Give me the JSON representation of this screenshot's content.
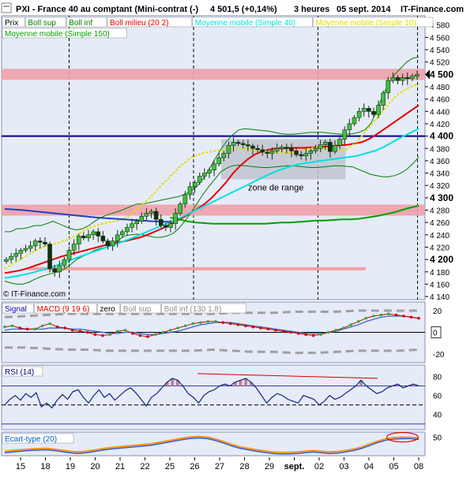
{
  "header": {
    "instrument": "PXI - France 40 au comptant (Mini-contrat  (-)",
    "price": "4 501,5 (+0,14%)",
    "interval": "3 heures",
    "date": "05 sept. 2014",
    "brand": "IT-Finance.com"
  },
  "legend_main": [
    {
      "label": "Prix",
      "color": "#000000"
    },
    {
      "label": "Boll sup",
      "color": "#008000"
    },
    {
      "label": "Boll inf",
      "color": "#008000"
    },
    {
      "label": "Boll milieu (20 2)",
      "color": "#e00000"
    },
    {
      "label": "Moyenne mobile (Simple 40)",
      "color": "#00e0e0"
    },
    {
      "label": "Moyenne mobile (Simple 10)",
      "color": "#e0e000"
    },
    {
      "label": "Moyenne mobile (Simple 150)",
      "color": "#00a000"
    }
  ],
  "copyright": "© IT-Finance.com",
  "annotation_range": "zone de range",
  "legend_macd": [
    {
      "label": "Signal",
      "color": "#0000c0"
    },
    {
      "label": "MACD (9 19 6)",
      "color": "#e00000"
    },
    {
      "label": "zero",
      "color": "#000000"
    },
    {
      "label": "Boll sup",
      "color": "#909090"
    },
    {
      "label": "Boll inf (130 1,8)",
      "color": "#909090"
    }
  ],
  "legend_rsi": [
    {
      "label": "RSI (14)",
      "color": "#000080"
    }
  ],
  "legend_ecart": [
    {
      "label": "Ecart-type (20)",
      "color": "#0060c0"
    }
  ],
  "chart_data": {
    "type": "line",
    "title": "PXI - France 40 au comptant (Mini-contrat  (-)",
    "x_ticks": [
      "15",
      "18",
      "19",
      "20",
      "21",
      "22",
      "25",
      "26",
      "27",
      "28",
      "29",
      "sept.",
      "02",
      "03",
      "04",
      "05",
      "08"
    ],
    "main_panel": {
      "ylim": [
        4135,
        4595
      ],
      "y_ticks": [
        "4 580",
        "4 560",
        "4 540",
        "4 520",
        "4 500",
        "4 480",
        "4 460",
        "4 440",
        "4 420",
        "4 400",
        "4 380",
        "4 360",
        "4 340",
        "4 320",
        "4 300",
        "4 280",
        "4 260",
        "4 240",
        "4 220",
        "4 200",
        "4 180",
        "4 160",
        "4 140"
      ],
      "y_ticks_bold": [
        "4 500",
        "4 400",
        "4 300",
        "4 200"
      ],
      "last_price_label": "4 500",
      "close": [
        4200,
        4205,
        4210,
        4215,
        4218,
        4222,
        4230,
        4228,
        4225,
        4185,
        4180,
        4190,
        4200,
        4215,
        4225,
        4238,
        4235,
        4240,
        4245,
        4238,
        4230,
        4222,
        4230,
        4240,
        4245,
        4252,
        4258,
        4262,
        4270,
        4275,
        4278,
        4265,
        4255,
        4252,
        4258,
        4275,
        4290,
        4305,
        4318,
        4325,
        4335,
        4340,
        4345,
        4355,
        4365,
        4372,
        4385,
        4390,
        4388,
        4386,
        4384,
        4380,
        4378,
        4374,
        4372,
        4376,
        4380,
        4382,
        4380,
        4376,
        4370,
        4368,
        4372,
        4376,
        4380,
        4386,
        4390,
        4375,
        4385,
        4395,
        4410,
        4420,
        4430,
        4440,
        4445,
        4440,
        4435,
        4450,
        4470,
        4490,
        4495,
        4490,
        4495,
        4493,
        4497,
        4500
      ],
      "series": [
        {
          "name": "Boll sup",
          "color": "#008000",
          "values": [
            4245,
            4245,
            4250,
            4250,
            4252,
            4255,
            4255,
            4258,
            4262,
            4258,
            4254,
            4250,
            4248,
            4250,
            4255,
            4262,
            4268,
            4272,
            4275,
            4278,
            4282,
            4286,
            4290,
            4290,
            4292,
            4294,
            4296,
            4298,
            4300,
            4302,
            4306,
            4310,
            4318,
            4330,
            4345,
            4362,
            4378,
            4392,
            4402,
            4410,
            4412,
            4411,
            4410,
            4409,
            4408,
            4406,
            4404,
            4403,
            4403,
            4404,
            4405,
            4406,
            4406,
            4406,
            4405,
            4404,
            4403,
            4403,
            4404,
            4406,
            4410,
            4420,
            4440,
            4465,
            4485,
            4500,
            4510,
            4520,
            4526,
            4528
          ]
        },
        {
          "name": "Boll inf",
          "color": "#008000",
          "values": [
            4165,
            4162,
            4160,
            4160,
            4163,
            4168,
            4172,
            4175,
            4178,
            4180,
            4185,
            4192,
            4200,
            4205,
            4210,
            4215,
            4218,
            4220,
            4225,
            4232,
            4238,
            4240,
            4241,
            4240,
            4238,
            4236,
            4236,
            4238,
            4242,
            4250,
            4262,
            4275,
            4290,
            4305,
            4318,
            4330,
            4342,
            4348,
            4352,
            4353,
            4352,
            4351,
            4350,
            4349,
            4349,
            4350,
            4351,
            4352,
            4352,
            4351,
            4350,
            4349,
            4349,
            4350,
            4351,
            4352,
            4352,
            4351,
            4350,
            4346,
            4342,
            4338,
            4336,
            4334,
            4334,
            4336,
            4340,
            4346,
            4355,
            4366
          ]
        },
        {
          "name": "Boll milieu (20 2)",
          "color": "#e00000",
          "values": [
            4178,
            4180,
            4182,
            4185,
            4189,
            4193,
            4197,
            4201,
            4205,
            4208,
            4211,
            4214,
            4217,
            4220,
            4223,
            4226,
            4228,
            4230,
            4233,
            4236,
            4240,
            4245,
            4250,
            4256,
            4262,
            4268,
            4275,
            4282,
            4290,
            4300,
            4312,
            4325,
            4340,
            4352,
            4362,
            4370,
            4375,
            4378,
            4380,
            4380,
            4381,
            4381,
            4381,
            4382,
            4382,
            4383,
            4384,
            4385,
            4386,
            4388,
            4390,
            4395,
            4402,
            4410,
            4418,
            4426,
            4434,
            4442,
            4450
          ]
        },
        {
          "name": "Moyenne mobile (Simple 40)",
          "color": "#00e0e0",
          "values": [
            4170,
            4172,
            4175,
            4178,
            4182,
            4186,
            4191,
            4196,
            4202,
            4207,
            4212,
            4217,
            4222,
            4227,
            4232,
            4238,
            4244,
            4250,
            4256,
            4262,
            4268,
            4275,
            4282,
            4289,
            4296,
            4303,
            4310,
            4317,
            4324,
            4331,
            4338,
            4344,
            4349,
            4353,
            4356,
            4358,
            4360,
            4362,
            4364,
            4366,
            4368,
            4372,
            4376,
            4382,
            4390,
            4398,
            4405,
            4412
          ]
        },
        {
          "name": "Moyenne mobile (Simple 10)",
          "color": "#e0e000",
          "values": [
            4185,
            4195,
            4205,
            4215,
            4222,
            4226,
            4232,
            4240,
            4250,
            4256,
            4260,
            4263,
            4270,
            4285,
            4300,
            4318,
            4335,
            4352,
            4365,
            4372,
            4375,
            4378,
            4380,
            4380,
            4378,
            4376,
            4374,
            4372,
            4374,
            4378,
            4382,
            4380,
            4376,
            4378,
            4390,
            4410,
            4430,
            4450,
            4468,
            4478,
            4485
          ]
        },
        {
          "name": "Moyenne mobile (Simple 150)",
          "color": "#00a000",
          "values": [
            4268,
            4265,
            4262,
            4260,
            4259,
            4258,
            4258,
            4258,
            4258,
            4258,
            4258,
            4258,
            4259,
            4260,
            4260,
            4261,
            4262,
            4263,
            4263,
            4264,
            4265,
            4265,
            4266,
            4268,
            4270,
            4273,
            4276,
            4280,
            4284,
            4287
          ]
        },
        {
          "name": "Moyenne mobile (Simple 150) ancienne",
          "color": "#2040c0",
          "values": [
            4282,
            4280,
            4277,
            4274,
            4271,
            4268,
            4266,
            4264,
            4262,
            4261
          ]
        }
      ],
      "horizontal_levels": [
        {
          "value": 4500,
          "kind": "band",
          "color": "#f0a0a8"
        },
        {
          "value": 4400,
          "kind": "line",
          "color": "#000090"
        },
        {
          "value": 4280,
          "kind": "band",
          "color": "#f0a0a8"
        },
        {
          "value": 4185,
          "kind": "thin-band",
          "color": "#f0a0a8"
        }
      ],
      "range_zone": {
        "from": "27",
        "to": "03",
        "low": 4330,
        "high": 4395
      }
    },
    "macd_panel": {
      "ylim": [
        -28,
        28
      ],
      "y_ticks": [
        "20",
        "0",
        "-20"
      ],
      "y_box": "0",
      "macd": [
        5,
        6,
        4,
        3,
        3,
        6,
        8,
        5,
        4,
        2,
        1,
        0,
        -2,
        -3,
        -2,
        1,
        2,
        -1,
        -3,
        -4,
        -2,
        0,
        2,
        4,
        6,
        8,
        9,
        10,
        10,
        9,
        8,
        7,
        6,
        5,
        4,
        3,
        2,
        1,
        0,
        -1,
        -2,
        -3,
        -2,
        0,
        2,
        4,
        7,
        10,
        13,
        15,
        16,
        17,
        16,
        15,
        14,
        13
      ],
      "signal": [
        2,
        3,
        3,
        3,
        3,
        3,
        4,
        4,
        4,
        3,
        3,
        2,
        1,
        0,
        -1,
        -1,
        0,
        0,
        -1,
        -2,
        -2,
        -1,
        0,
        1,
        3,
        5,
        7,
        8,
        9,
        9,
        9,
        8,
        7,
        6,
        5,
        4,
        3,
        2,
        1,
        0,
        -1,
        -1,
        -1,
        0,
        1,
        3,
        5,
        7,
        10,
        12,
        14,
        15,
        15,
        15,
        14,
        13
      ],
      "boll_sup": [
        14,
        15,
        16,
        17,
        17,
        17,
        17,
        17,
        17,
        17,
        17,
        18,
        18,
        18,
        19,
        19,
        19,
        20,
        20,
        20,
        20
      ],
      "boll_inf": [
        -14,
        -14,
        -15,
        -16,
        -16,
        -17,
        -17,
        -17,
        -17,
        -17,
        -16,
        -17,
        -18,
        -18,
        -19,
        -19,
        -18,
        -17,
        -17,
        -17,
        -16
      ]
    },
    "rsi_panel": {
      "ylim": [
        24,
        92
      ],
      "y_ticks": [
        "80",
        "60",
        "40"
      ],
      "levels": [
        70,
        50,
        30
      ],
      "values": [
        50,
        56,
        60,
        55,
        62,
        58,
        63,
        48,
        52,
        47,
        55,
        61,
        56,
        64,
        66,
        58,
        52,
        60,
        66,
        58,
        62,
        55,
        60,
        65,
        68,
        63,
        56,
        49,
        58,
        62,
        68,
        74,
        78,
        76,
        70,
        62,
        58,
        52,
        60,
        64,
        66,
        70,
        72,
        70,
        74,
        76,
        78,
        74,
        68,
        60,
        52,
        58,
        62,
        60,
        56,
        54,
        52,
        60,
        58,
        56,
        50,
        54,
        60,
        56,
        58,
        62,
        66,
        70,
        76,
        70,
        66,
        62,
        64,
        68,
        70,
        72,
        68,
        70,
        72,
        70
      ]
    },
    "ecart_panel": {
      "ylim": [
        0,
        64
      ],
      "y_ticks": [
        "50"
      ],
      "values": [
        12,
        14,
        16,
        18,
        19,
        20,
        18,
        15,
        12,
        10,
        12,
        15,
        19,
        22,
        24,
        26,
        28,
        30,
        32,
        36,
        40,
        44,
        48,
        51,
        52,
        50,
        45,
        38,
        30,
        24,
        20,
        16,
        13,
        10,
        9,
        9,
        10,
        12,
        14,
        12,
        10,
        11,
        14,
        18,
        24,
        32,
        40,
        46,
        49,
        50,
        50,
        48
      ]
    }
  }
}
